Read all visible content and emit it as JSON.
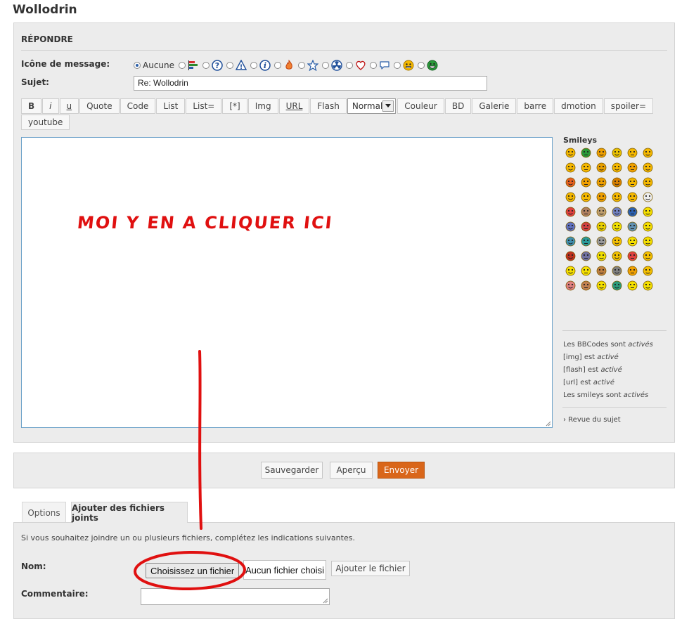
{
  "page": {
    "title": "Wollodrin"
  },
  "reply": {
    "heading": "RÉPONDRE",
    "message_icon_label": "Icône de message:",
    "message_icon_none": "Aucune",
    "subject_label": "Sujet:",
    "subject_value": "Re: Wollodrin",
    "message_icons": [
      "bar-chart-icon",
      "question-icon",
      "warning-icon",
      "info-icon",
      "fire-icon",
      "star-icon",
      "radioactive-icon",
      "heart-icon",
      "speech-bubble-icon",
      "face-icon",
      "grin-icon"
    ]
  },
  "toolbar": {
    "row1": [
      "B",
      "i",
      "u",
      "Quote",
      "Code",
      "List",
      "List=",
      "[*]",
      "Img",
      "URL",
      "Flash"
    ],
    "size_select": "Normale",
    "row1b": [
      "Couleur",
      "BD",
      "Galerie",
      "barre",
      "dmotion",
      "spoiler="
    ],
    "row2": [
      "youtube"
    ]
  },
  "annotation": {
    "text": "MOI Y EN A CLIQUER ICI",
    "color": "#e01010"
  },
  "sidebar": {
    "smileys_title": "Smileys",
    "bbcode_prefix": "Les BBCodes sont",
    "bbcode_state": "activés",
    "img_prefix": "[img] est",
    "img_state": "activé",
    "flash_prefix": "[flash] est",
    "flash_state": "activé",
    "url_prefix": "[url] est",
    "url_state": "activé",
    "smileys_prefix": "Les smileys sont",
    "smileys_state": "activés",
    "review_link": "› Revue du sujet"
  },
  "submit": {
    "save": "Sauvegarder",
    "preview": "Aperçu",
    "send": "Envoyer",
    "accent": "#d9661a"
  },
  "tabs": {
    "options": "Options",
    "attachments": "Ajouter des fichiers joints"
  },
  "attach": {
    "description": "Si vous souhaitez joindre un ou plusieurs fichiers, complétez les indications suivantes.",
    "name_label": "Nom:",
    "choose_file": "Choisissez un fichier",
    "no_file": "Aucun fichier choisi",
    "add_file": "Ajouter le fichier",
    "comment_label": "Commentaire:"
  }
}
